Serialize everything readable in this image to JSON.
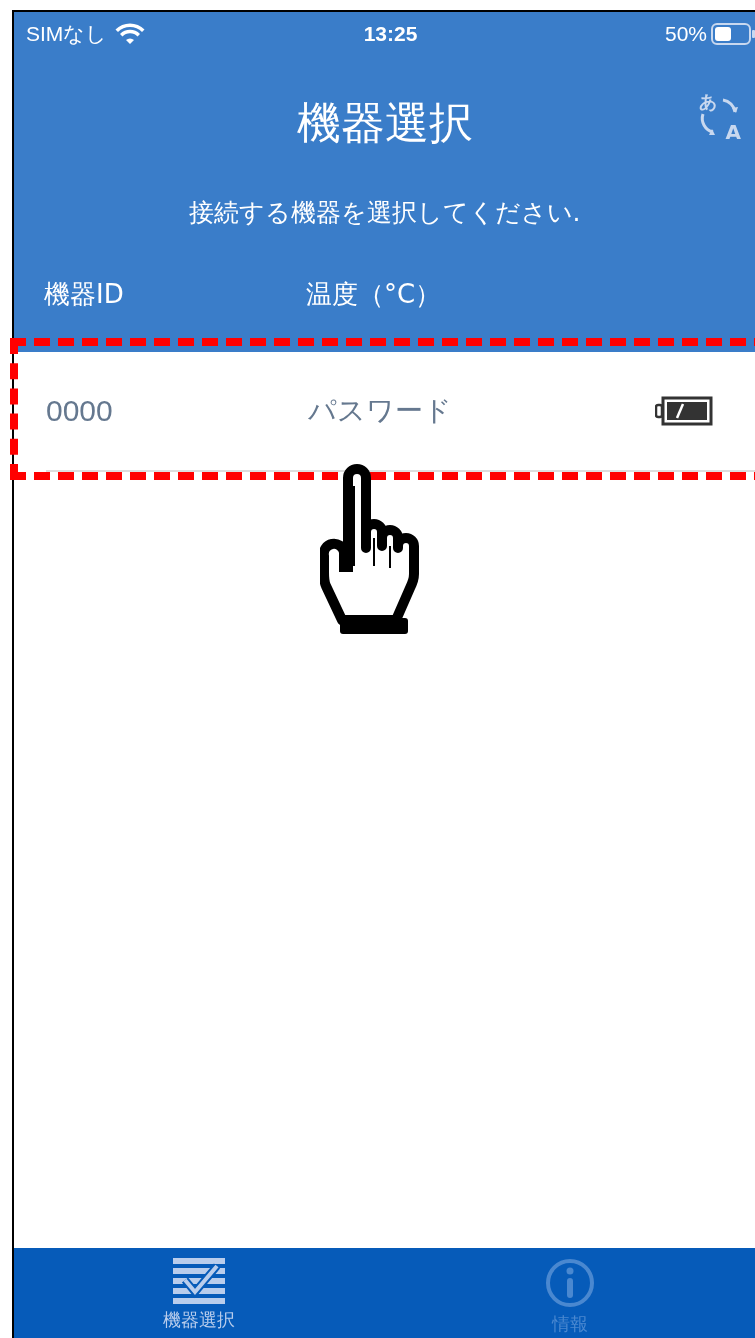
{
  "status_bar": {
    "carrier": "SIMなし",
    "time": "13:25",
    "battery": "50%"
  },
  "header": {
    "title": "機器選択",
    "subtitle": "接続する機器を選択してください.",
    "language_button": {
      "top": "あ",
      "bottom": "A"
    }
  },
  "table": {
    "columns": [
      "機器ID",
      "温度（°C）"
    ],
    "rows": [
      {
        "id": "0000",
        "value": "パスワード"
      }
    ]
  },
  "annotation": {
    "highlight": true,
    "pointer": true
  },
  "tabs": [
    {
      "label": "機器選択",
      "kind": "checklist",
      "selected": true
    },
    {
      "label": "情報",
      "kind": "info",
      "selected": false
    }
  ]
}
